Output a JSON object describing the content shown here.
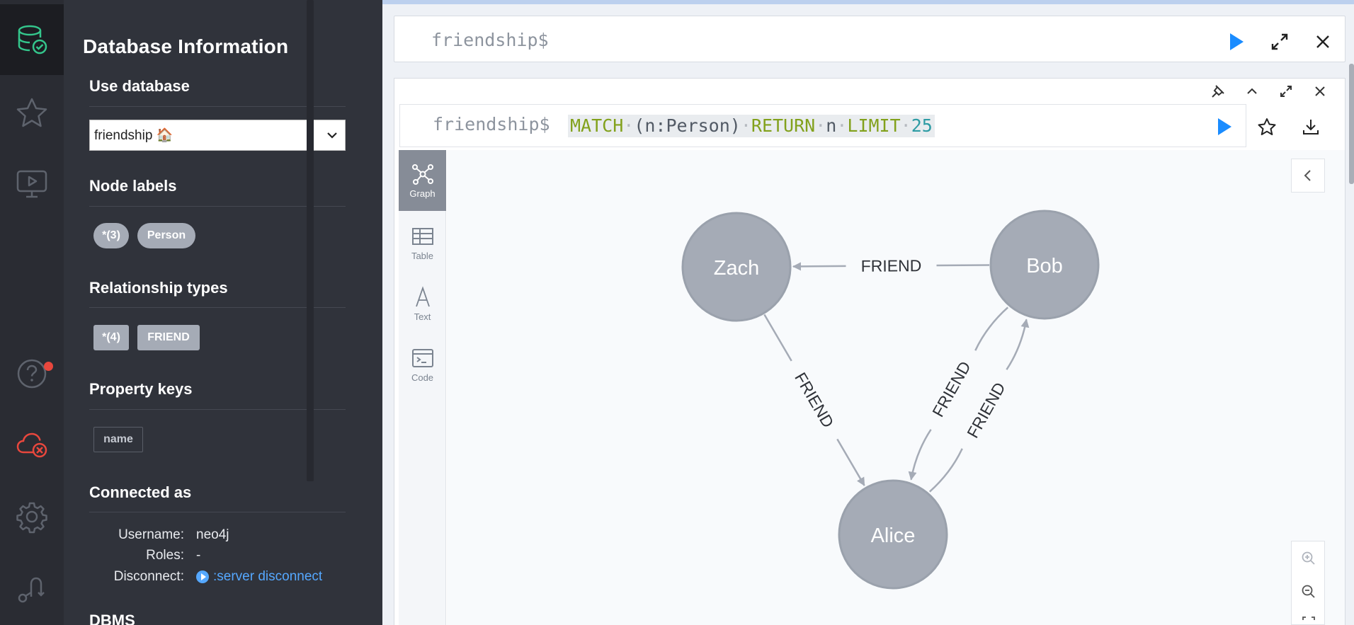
{
  "drawer": {
    "title": "Database Information",
    "use_database_heading": "Use database",
    "db_selected": "friendship 🏠",
    "node_labels_heading": "Node labels",
    "node_labels": [
      "*(3)",
      "Person"
    ],
    "rel_types_heading": "Relationship types",
    "rel_types": [
      "*(4)",
      "FRIEND"
    ],
    "property_keys_heading": "Property keys",
    "property_keys": [
      "name"
    ],
    "connected_heading": "Connected as",
    "username_label": "Username:",
    "username": "neo4j",
    "roles_label": "Roles:",
    "roles": "-",
    "disconnect_label": "Disconnect:",
    "disconnect_link": ":server disconnect",
    "dbms_heading": "DBMS"
  },
  "editor": {
    "prompt": "friendship$"
  },
  "frame": {
    "prompt": "friendship$",
    "query_tokens": [
      {
        "t": "MATCH",
        "c": "kw"
      },
      {
        "t": "·",
        "c": "dot"
      },
      {
        "t": "(n:Person)",
        "c": "sym"
      },
      {
        "t": "·",
        "c": "dot"
      },
      {
        "t": "RETURN",
        "c": "kw"
      },
      {
        "t": "·",
        "c": "dot"
      },
      {
        "t": "n",
        "c": "sym"
      },
      {
        "t": "·",
        "c": "dot"
      },
      {
        "t": "LIMIT",
        "c": "kw"
      },
      {
        "t": "·",
        "c": "dot"
      },
      {
        "t": "25",
        "c": "num"
      }
    ],
    "view_tabs": [
      {
        "label": "Graph",
        "icon": "graph-icon",
        "active": true
      },
      {
        "label": "Table",
        "icon": "table-icon",
        "active": false
      },
      {
        "label": "Text",
        "icon": "text-icon",
        "active": false
      },
      {
        "label": "Code",
        "icon": "code-icon",
        "active": false
      }
    ]
  },
  "graph": {
    "nodes": [
      {
        "id": "zach",
        "label": "Zach"
      },
      {
        "id": "bob",
        "label": "Bob"
      },
      {
        "id": "alice",
        "label": "Alice"
      }
    ],
    "edges": [
      {
        "from": "bob",
        "to": "zach",
        "label": "FRIEND"
      },
      {
        "from": "zach",
        "to": "alice",
        "label": "FRIEND"
      },
      {
        "from": "alice",
        "to": "bob",
        "label": "FRIEND"
      },
      {
        "from": "bob",
        "to": "alice",
        "label": "FRIEND"
      }
    ],
    "node_color": "#a5abb6",
    "node_border": "#9aa1ac",
    "edge_color": "#a5abb6"
  },
  "colors": {
    "accent": "#1a8cff",
    "alert": "#e8473d"
  }
}
